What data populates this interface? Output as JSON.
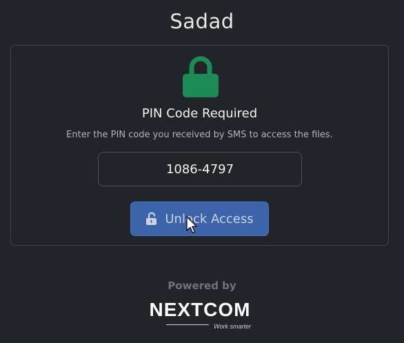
{
  "app": {
    "title": "Sadad"
  },
  "card": {
    "icon": "lock-icon",
    "title": "PIN Code Required",
    "subtitle": "Enter the PIN code you received by SMS to access the files.",
    "pin_value": "1086-4797",
    "unlock_label": "Unlock Access",
    "unlock_icon": "unlock-icon"
  },
  "footer": {
    "powered_by": "Powered by",
    "brand": "NEXTCOM",
    "tagline": "Work smarter"
  },
  "colors": {
    "background": "#212529",
    "lock_green": "#1e8a57",
    "button_blue": "#3d64a8"
  }
}
